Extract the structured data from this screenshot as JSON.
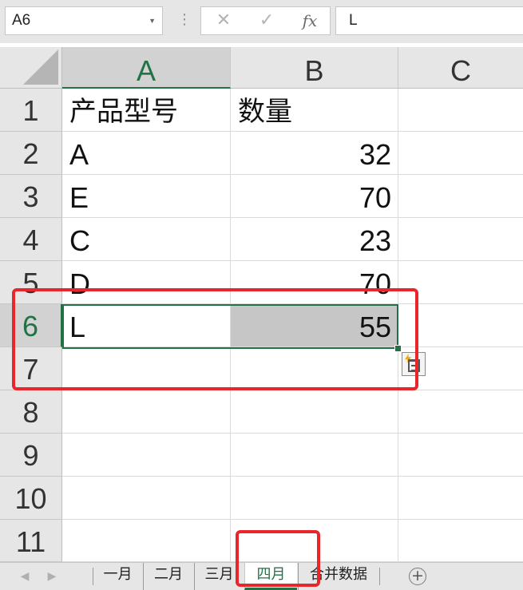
{
  "name_box": {
    "value": "A6"
  },
  "formula_bar": {
    "cancel_glyph": "✕",
    "enter_glyph": "✓",
    "fx_label": "fx",
    "value": "L"
  },
  "columns": [
    "A",
    "B",
    "C"
  ],
  "selected_column": "A",
  "rows": [
    {
      "num": "1",
      "a": "产品型号",
      "b": "数量"
    },
    {
      "num": "2",
      "a": "A",
      "b": "32"
    },
    {
      "num": "3",
      "a": "E",
      "b": "70"
    },
    {
      "num": "4",
      "a": "C",
      "b": "23"
    },
    {
      "num": "5",
      "a": "D",
      "b": "70"
    },
    {
      "num": "6",
      "a": "L",
      "b": "55"
    },
    {
      "num": "7",
      "a": "",
      "b": ""
    },
    {
      "num": "8",
      "a": "",
      "b": ""
    },
    {
      "num": "9",
      "a": "",
      "b": ""
    },
    {
      "num": "10",
      "a": "",
      "b": ""
    },
    {
      "num": "11",
      "a": "",
      "b": ""
    }
  ],
  "selection": {
    "active_cell": "A6",
    "range": "A6:B6"
  },
  "sheet_tabs": [
    {
      "label": "一月",
      "active": false
    },
    {
      "label": "二月",
      "active": false
    },
    {
      "label": "三月",
      "active": false
    },
    {
      "label": "四月",
      "active": true
    },
    {
      "label": "合并数据",
      "active": false
    }
  ],
  "add_sheet_glyph": "+",
  "colors": {
    "excel_green": "#217346",
    "annotation_red": "#e8262b",
    "selection_fill": "#c6c6c6",
    "header_bg": "#e6e6e6"
  },
  "icons": [
    "chevron-down-icon",
    "cancel-icon",
    "enter-check-icon",
    "fx-icon",
    "quick-analysis-icon",
    "add-sheet-icon",
    "nav-left-icon",
    "nav-right-icon"
  ]
}
